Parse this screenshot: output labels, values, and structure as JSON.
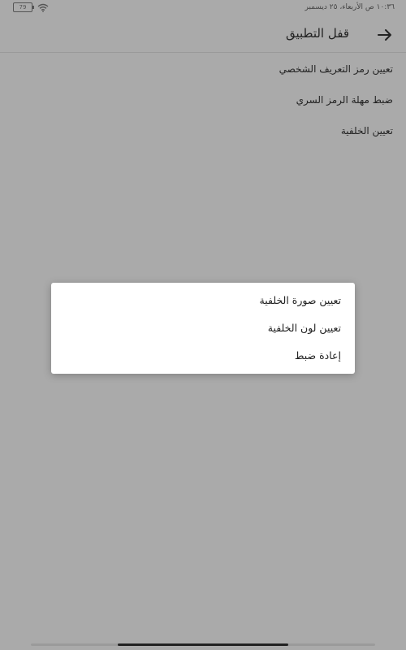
{
  "status_bar": {
    "text": "١٠:٣٦ ص  الأربعاء، ٢٥ ديسمبر",
    "battery": "79",
    "wifi_icon": "wifi-icon",
    "battery_icon": "battery-icon"
  },
  "header": {
    "title": "قفل التطبيق",
    "back_icon": "arrow-right-icon"
  },
  "settings": {
    "items": [
      {
        "label": "تعيين رمز التعريف الشخصي"
      },
      {
        "label": "ضبط مهلة الرمز السري"
      },
      {
        "label": "تعيين الخلفية"
      }
    ]
  },
  "dialog": {
    "options": [
      {
        "label": "تعيين صورة الخلفية"
      },
      {
        "label": "تعيين لون الخلفية"
      },
      {
        "label": "إعادة ضبط"
      }
    ]
  },
  "colors": {
    "overlay_background": "#aaaaaa",
    "dialog_background": "#ffffff",
    "text": "#222222"
  }
}
